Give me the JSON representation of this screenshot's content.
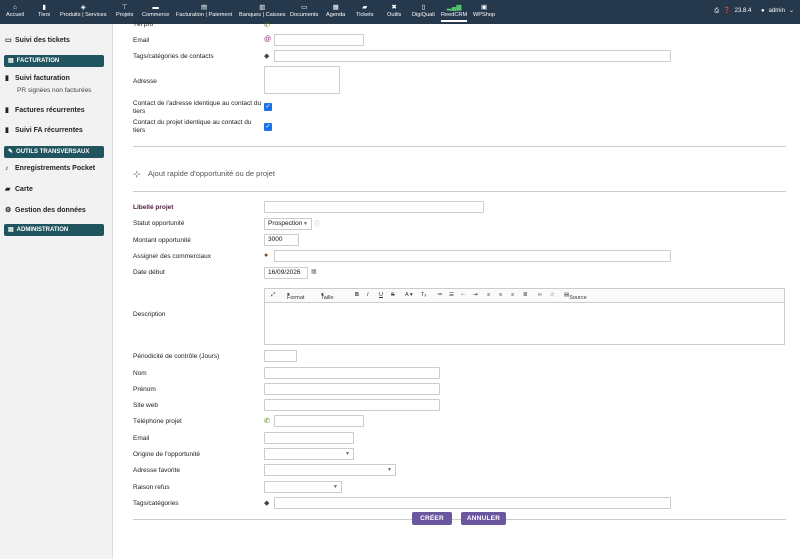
{
  "topnav": {
    "items": [
      {
        "label": "Accueil",
        "icon": "home-icon"
      },
      {
        "label": "Tiers",
        "icon": "building-icon"
      },
      {
        "label": "Produits | Services",
        "icon": "cube-icon"
      },
      {
        "label": "Projets",
        "icon": "sitemap-icon"
      },
      {
        "label": "Commerce",
        "icon": "briefcase-icon"
      },
      {
        "label": "Facturation | Paiement",
        "icon": "invoice-icon"
      },
      {
        "label": "Banques | Caisses",
        "icon": "bank-icon"
      },
      {
        "label": "Documents",
        "icon": "folder-icon"
      },
      {
        "label": "Agenda",
        "icon": "calendar-icon"
      },
      {
        "label": "Tickets",
        "icon": "ticket-icon"
      },
      {
        "label": "Outils",
        "icon": "tools-icon"
      },
      {
        "label": "DigiQuali",
        "icon": "clipboard-icon"
      },
      {
        "label": "ReedCRM",
        "icon": "chart-icon"
      },
      {
        "label": "WPShop",
        "icon": "shop-icon"
      }
    ],
    "version": "23.8.4",
    "user": "admin"
  },
  "sidebar": {
    "tickets": "Suivi des tickets",
    "facturation_head": "FACTURATION",
    "suivi_facturation": "Suivi facturation",
    "pr_signees": "PR signées non facturées",
    "factures_recurrentes": "Factures récurrentes",
    "suivi_fa": "Suivi FA récurrentes",
    "outils_head": "OUTILS TRANSVERSAUX",
    "enregistrements": "Enregistrements Pocket",
    "carte": "Carte",
    "gestion": "Gestion des données",
    "admin_head": "ADMINISTRATION"
  },
  "form": {
    "tel_pro_label": "Tél pro",
    "email_label": "Email",
    "email_value": "",
    "tags_contacts_label": "Tags/catégories de contacts",
    "adresse_label": "Adresse",
    "contact_adresse_label": "Contact de l'adresse identique au contact du tiers",
    "contact_projet_label": "Contact du projet identique au contact du tiers",
    "section_title": "Ajout rapide d'opportunité ou de projet",
    "libelle_label": "Libellé projet",
    "statut_label": "Statut opportunité",
    "statut_value": "Prospection",
    "montant_label": "Montant opportunité",
    "montant_value": "3000",
    "assigner_label": "Assigner des commerciaux",
    "date_label": "Date début",
    "date_value": "16/09/2026",
    "description_label": "Description",
    "editor_format": "Format",
    "editor_taille": "Taille",
    "editor_source": "Source",
    "periodicite_label": "Périodicité de contrôle (Jours)",
    "nom_label": "Nom",
    "prenom_label": "Prénom",
    "siteweb_label": "Site web",
    "telephone_label": "Téléphone projet",
    "email2_label": "Email",
    "origine_label": "Origine de l'opportunité",
    "adresse_fav_label": "Adresse favorite",
    "raison_label": "Raison refus",
    "tags_label": "Tags/catégories"
  },
  "buttons": {
    "create": "CRÉER",
    "cancel": "ANNULER"
  },
  "colors": {
    "topbar": "#26384c",
    "sidebar_head": "#20545e",
    "button": "#6a57a0",
    "checkbox": "#1a73e8"
  }
}
